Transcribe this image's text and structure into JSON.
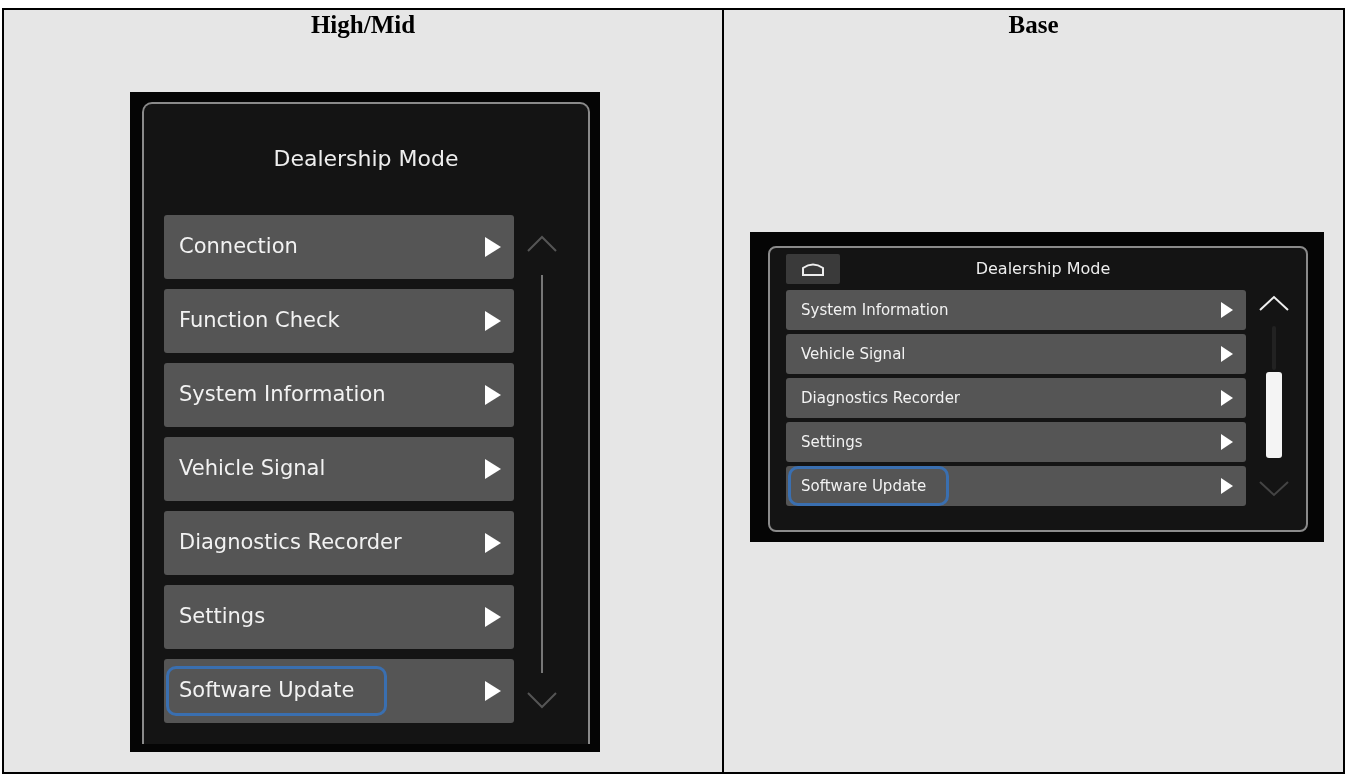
{
  "columns": [
    {
      "heading": "High/Mid",
      "screen": {
        "kind": "tall",
        "title": "Dealership Mode",
        "home_button": false,
        "items": [
          {
            "label": "Connection",
            "highlighted": false
          },
          {
            "label": "Function Check",
            "highlighted": false
          },
          {
            "label": "System Information",
            "highlighted": false
          },
          {
            "label": "Vehicle Signal",
            "highlighted": false
          },
          {
            "label": "Diagnostics Recorder",
            "highlighted": false
          },
          {
            "label": "Settings",
            "highlighted": false
          },
          {
            "label": "Software Update",
            "highlighted": true
          }
        ]
      }
    },
    {
      "heading": "Base",
      "screen": {
        "kind": "wide",
        "title": "Dealership Mode",
        "home_button": true,
        "items": [
          {
            "label": "System Information",
            "highlighted": false
          },
          {
            "label": "Vehicle Signal",
            "highlighted": false
          },
          {
            "label": "Diagnostics Recorder",
            "highlighted": false
          },
          {
            "label": "Settings",
            "highlighted": false
          },
          {
            "label": "Software Update",
            "highlighted": true
          }
        ]
      }
    }
  ]
}
